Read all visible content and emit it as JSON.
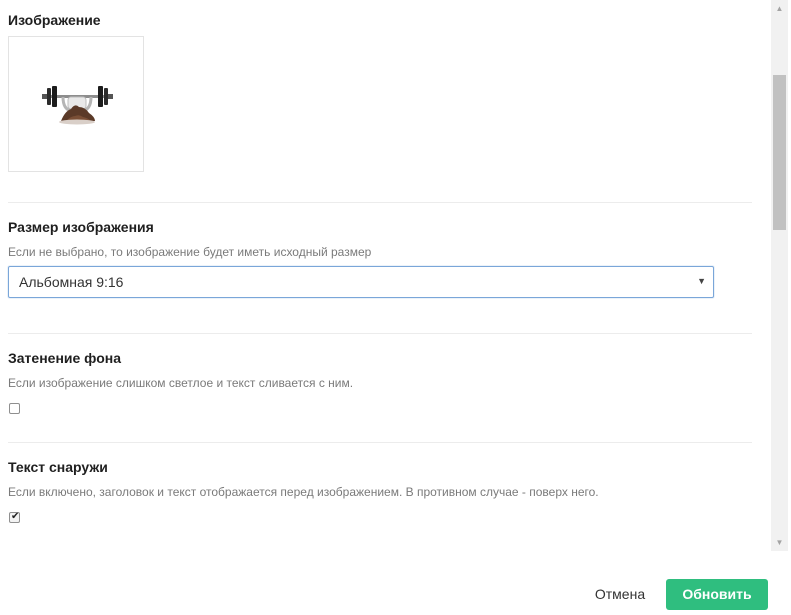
{
  "image_section": {
    "title": "Изображение",
    "thumbnail_icon": "dumbbell-coffee-icon"
  },
  "size_section": {
    "title": "Размер изображения",
    "hint": "Если не выбрано, то изображение будет иметь исходный размер",
    "selected_value": "Альбомная 9:16"
  },
  "darken_section": {
    "title": "Затенение фона",
    "hint": "Если изображение слишком светлое и текст сливается с ним.",
    "checked": false
  },
  "outside_text_section": {
    "title": "Текст снаружи",
    "hint": "Если включено, заголовок и текст отображается перед изображением. В противном случае - поверх него.",
    "checked": true
  },
  "footer": {
    "cancel_label": "Отмена",
    "update_label": "Обновить"
  },
  "colors": {
    "primary": "#2fbe7f",
    "select_border": "#7aa6d9"
  }
}
